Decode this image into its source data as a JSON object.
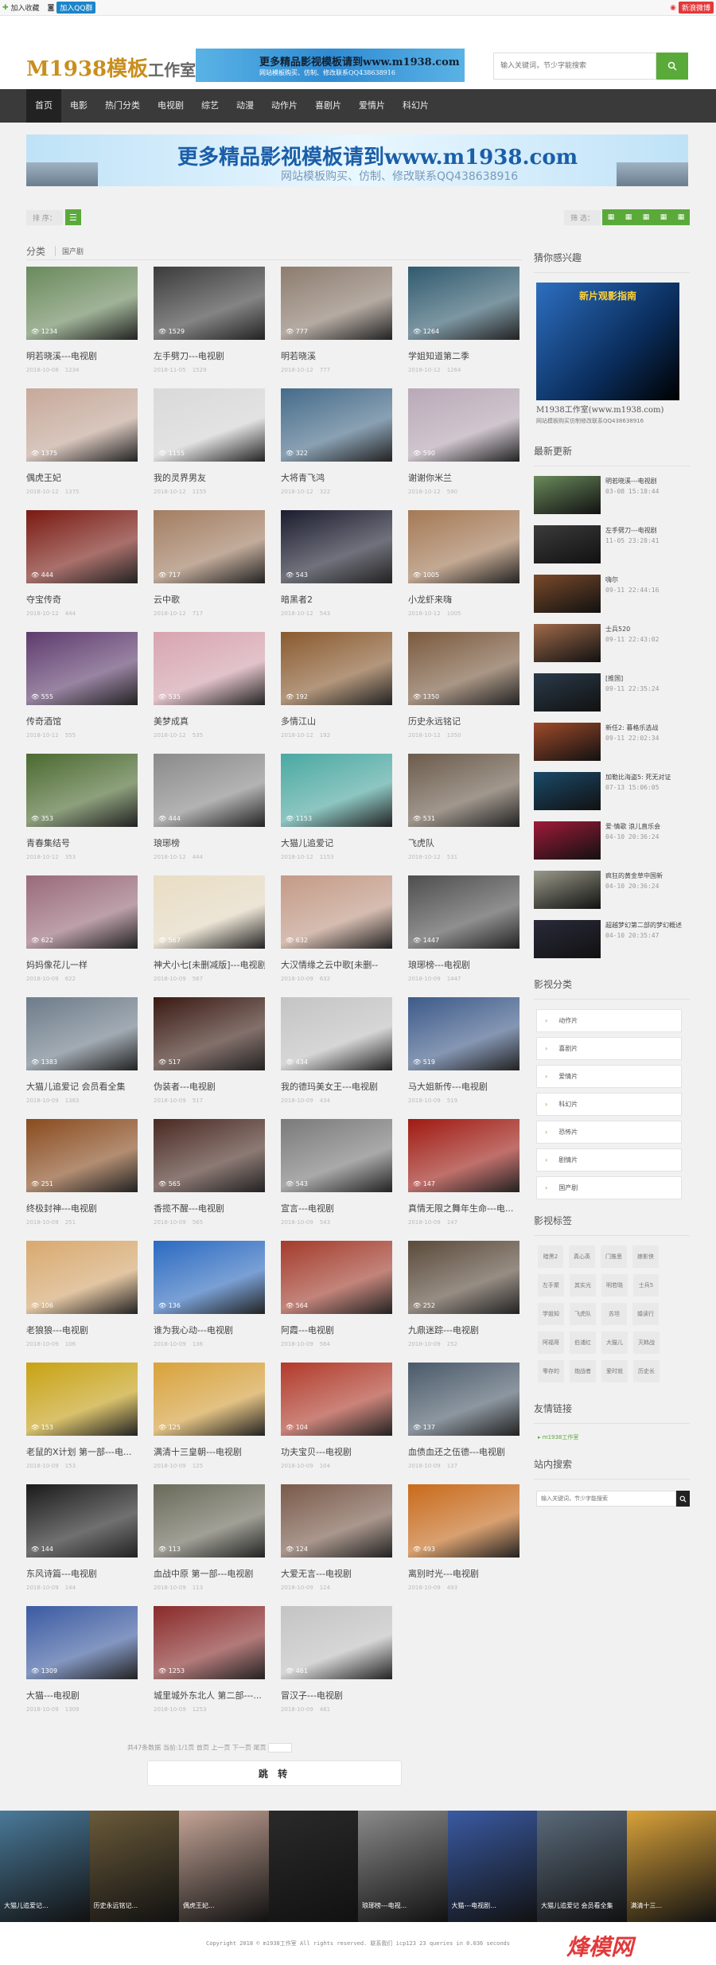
{
  "topbar": {
    "fav": "加入收藏",
    "qq": "加入QQ群",
    "weibo": "新浪微博"
  },
  "header": {
    "logo_main": "M1938模板",
    "logo_sub": "工作室",
    "banner_title": "更多精品影视模板请到www.m1938.com",
    "banner_sub": "网站模板购买、仿制、修改联系QQ438638916",
    "search_placeholder": "输入关键词，节少字能搜索"
  },
  "nav": [
    "首页",
    "电影",
    "热门分类",
    "电视剧",
    "综艺",
    "动漫",
    "动作片",
    "喜剧片",
    "爱情片",
    "科幻片"
  ],
  "banner": {
    "title": "更多精品影视模板请到www.m1938.com",
    "subtitle": "网站模板购买、仿制、修改联系QQ438638916"
  },
  "toolbar": {
    "sort_label": "排 序：",
    "filter_label": "筛 选："
  },
  "category": {
    "title": "分类",
    "sub": "国产剧"
  },
  "items": [
    {
      "title": "明若晓溪---电视剧",
      "date": "2018-10-08",
      "views": "1234",
      "c": "#6a8a5c"
    },
    {
      "title": "左手劈刀---电视剧",
      "date": "2018-11-05",
      "views": "1529",
      "c": "#3b3b3b"
    },
    {
      "title": "明若晓溪",
      "date": "2018-10-12",
      "views": "777",
      "c": "#8d7c6e"
    },
    {
      "title": "学姐知道第二季",
      "date": "2018-10-12",
      "views": "1264",
      "c": "#2f5a6e"
    },
    {
      "title": "偶虎王妃",
      "date": "2018-10-12",
      "views": "1375",
      "c": "#c7a99a"
    },
    {
      "title": "我的灵界男友",
      "date": "2018-10-12",
      "views": "1155",
      "c": "#d9d9d9"
    },
    {
      "title": "大将青飞鸿",
      "date": "2018-10-12",
      "views": "322",
      "c": "#456b8a"
    },
    {
      "title": "谢谢你米兰",
      "date": "2018-10-12",
      "views": "590",
      "c": "#b9a9b7"
    },
    {
      "title": "夺宝传奇",
      "date": "2018-10-12",
      "views": "444",
      "c": "#7a1a12"
    },
    {
      "title": "云中歌",
      "date": "2018-10-12",
      "views": "717",
      "c": "#a37d61"
    },
    {
      "title": "暗黑者2",
      "date": "2018-10-12",
      "views": "543",
      "c": "#1b1c2e"
    },
    {
      "title": "小龙虾来嗨",
      "date": "2018-10-12",
      "views": "1005",
      "c": "#a57955"
    },
    {
      "title": "传奇酒馆",
      "date": "2018-10-12",
      "views": "555",
      "c": "#5e3b6e"
    },
    {
      "title": "美梦成真",
      "date": "2018-10-12",
      "views": "535",
      "c": "#d8a4b0"
    },
    {
      "title": "多情江山",
      "date": "2018-10-12",
      "views": "192",
      "c": "#8a5a2e"
    },
    {
      "title": "历史永远铭记",
      "date": "2018-10-12",
      "views": "1350",
      "c": "#7b5a3e"
    },
    {
      "title": "青春集结号",
      "date": "2018-10-12",
      "views": "353",
      "c": "#4b6a2f"
    },
    {
      "title": "琅琊榜",
      "date": "2018-10-12",
      "views": "444",
      "c": "#8a8a8a"
    },
    {
      "title": "大猫儿追爱记",
      "date": "2018-10-12",
      "views": "1153",
      "c": "#4aa9a2"
    },
    {
      "title": "飞虎队",
      "date": "2018-10-12",
      "views": "531",
      "c": "#6b5b4b"
    },
    {
      "title": "妈妈像花儿一样",
      "date": "2018-10-09",
      "views": "622",
      "c": "#9a6a7a"
    },
    {
      "title": "神犬小七[未删减版]---电视剧",
      "date": "2018-10-09",
      "views": "567",
      "c": "#e9ddc4"
    },
    {
      "title": "大汉情缘之云中歌[未删--",
      "date": "2018-10-09",
      "views": "632",
      "c": "#c49a86"
    },
    {
      "title": "琅琊榜---电视剧",
      "date": "2018-10-09",
      "views": "1447",
      "c": "#4e4e4e"
    },
    {
      "title": "大猫儿追爱记 会员看全集",
      "date": "2018-10-09",
      "views": "1383",
      "c": "#6d7c8a"
    },
    {
      "title": "伪装者---电视剧",
      "date": "2018-10-09",
      "views": "517",
      "c": "#3a1a12"
    },
    {
      "title": "我的德玛美女王---电视剧",
      "date": "2018-10-09",
      "views": "434",
      "c": "#c4c4c4"
    },
    {
      "title": "马大姐新传---电视剧",
      "date": "2018-10-09",
      "views": "519",
      "c": "#3d5a8a"
    },
    {
      "title": "终极封神---电视剧",
      "date": "2018-10-09",
      "views": "251",
      "c": "#8a4b1e"
    },
    {
      "title": "香揽不醒---电视剧",
      "date": "2018-10-09",
      "views": "565",
      "c": "#4a2a22"
    },
    {
      "title": "宣言---电视剧",
      "date": "2018-10-09",
      "views": "543",
      "c": "#7a7a7a"
    },
    {
      "title": "真情无限之舞年生命---电...",
      "date": "2018-10-09",
      "views": "147",
      "c": "#a01a12"
    },
    {
      "title": "老狼狼---电视剧",
      "date": "2018-10-09",
      "views": "106",
      "c": "#d9a96e"
    },
    {
      "title": "谁为我心动---电视剧",
      "date": "2018-10-09",
      "views": "136",
      "c": "#2a6ac2"
    },
    {
      "title": "阿霞---电视剧",
      "date": "2018-10-09",
      "views": "564",
      "c": "#a43b2b"
    },
    {
      "title": "九鼎迷踪---电视剧",
      "date": "2018-10-09",
      "views": "252",
      "c": "#5a4a3a"
    },
    {
      "title": "老鼠的X计划 第一部---电...",
      "date": "2018-10-09",
      "views": "153",
      "c": "#c9a212"
    },
    {
      "title": "满清十三皇朝---电视剧",
      "date": "2018-10-09",
      "views": "125",
      "c": "#d9a23a"
    },
    {
      "title": "功夫宝贝---电视剧",
      "date": "2018-10-09",
      "views": "104",
      "c": "#b23a2a"
    },
    {
      "title": "血债血还之伍德---电视剧",
      "date": "2018-10-09",
      "views": "137",
      "c": "#4a5a6a"
    },
    {
      "title": "东风诗篇---电视剧",
      "date": "2018-10-09",
      "views": "144",
      "c": "#1a1a1a"
    },
    {
      "title": "血战中原 第一部---电视剧",
      "date": "2018-10-09",
      "views": "113",
      "c": "#6a6a5a"
    },
    {
      "title": "大爱无言---电视剧",
      "date": "2018-10-09",
      "views": "124",
      "c": "#7a5a4a"
    },
    {
      "title": "离别时光---电视剧",
      "date": "2018-10-09",
      "views": "493",
      "c": "#c96a1a"
    },
    {
      "title": "大猫---电视剧",
      "date": "2018-10-09",
      "views": "1309",
      "c": "#3a5aa2"
    },
    {
      "title": "城里城外东北人 第二部---...",
      "date": "2018-10-09",
      "views": "1253",
      "c": "#8a2a2a"
    },
    {
      "title": "冒汉子---电视剧",
      "date": "2018-10-09",
      "views": "461",
      "c": "#c4c4c4"
    }
  ],
  "pager": {
    "text": "共47条数据 当前:1/1页 首页 上一页 下一页 尾页",
    "jump": "跳 转"
  },
  "side": {
    "interest_title": "猜你感兴趣",
    "ad_title": "新片观影指南",
    "ad_text": "M1938工作室(www.m1938.com)",
    "ad_text2": "网站模板购买仿制修改联系QQ438638916",
    "latest_title": "最新更新",
    "latest": [
      {
        "t": "明若晓溪---电视剧",
        "d": "03-08 15:18:44",
        "c": "#6a8a5c"
      },
      {
        "t": "左手劈刀---电视剧",
        "d": "11-05 23:28:41",
        "c": "#3b3b3b"
      },
      {
        "t": "嗨尔",
        "d": "09-11 22:44:16",
        "c": "#7a4a2a"
      },
      {
        "t": "士兵520",
        "d": "09-11 22:43:02",
        "c": "#a06a4a"
      },
      {
        "t": "[推国]",
        "d": "09-11 22:35:24",
        "c": "#2a3a4a"
      },
      {
        "t": "新任2: 暮格乐选战",
        "d": "09-11 22:02:34",
        "c": "#a04a2a"
      },
      {
        "t": "加勒比海盗5: 死无对证",
        "d": "07-13 15:06:05",
        "c": "#1a4a6a"
      },
      {
        "t": "爱·情歌 浪儿直乐会",
        "d": "04-10 20:36:24",
        "c": "#a01a3a"
      },
      {
        "t": "疯狂的黄金草中国新",
        "d": "04-10 20:36:24",
        "c": "#9a9a8a"
      },
      {
        "t": "超越梦幻第二部的梦幻概述",
        "d": "04-10 20:35:47",
        "c": "#2a2a3a"
      }
    ],
    "cat_title": "影视分类",
    "cats": [
      "动作片",
      "喜剧片",
      "爱情片",
      "科幻片",
      "恐怖片",
      "剧情片",
      "国产剧"
    ],
    "tag_title": "影视标签",
    "tags": [
      "暗黑2",
      "真心英",
      "门推思",
      "娘影侠",
      "左手聚",
      "其实光",
      "明若晓",
      "士兵5",
      "学姐知",
      "飞虎队",
      "苏坦",
      "婚读行",
      "阿福哥",
      "伯浦红",
      "大猫儿",
      "灭韩战",
      "零存的",
      "炮战者",
      "爱时就",
      "历史长"
    ],
    "links_title": "友情链接",
    "link": "m1938工作室",
    "search_title": "站内搜索",
    "search_placeholder": "输入关键词，节少字能搜索"
  },
  "strip": [
    {
      "cap": "大猫儿追爱记...",
      "c": "#4a7a9a"
    },
    {
      "cap": "历史永远铭记...",
      "c": "#6a5a3a"
    },
    {
      "cap": "偶虎王妃...",
      "c": "#c4a496"
    },
    {
      "cap": "",
      "c": "#2a2a2a"
    },
    {
      "cap": "琅琊榜---电视...",
      "c": "#8a8a8a"
    },
    {
      "cap": "大猫---电视剧...",
      "c": "#3a5aa2"
    },
    {
      "cap": "大猫儿追爱记 会员看全集",
      "c": "#5a6a7a"
    },
    {
      "cap": "满清十三...",
      "c": "#d9a23a"
    }
  ],
  "footer": {
    "copyright": "Copyright 2018 © m1938工作室 All rights reserved. 联系我们 icp123 23 queries in 0.036 seconds",
    "brand": "m1938工作室",
    "contact": "联系我们",
    "watermark": "烽模网"
  }
}
